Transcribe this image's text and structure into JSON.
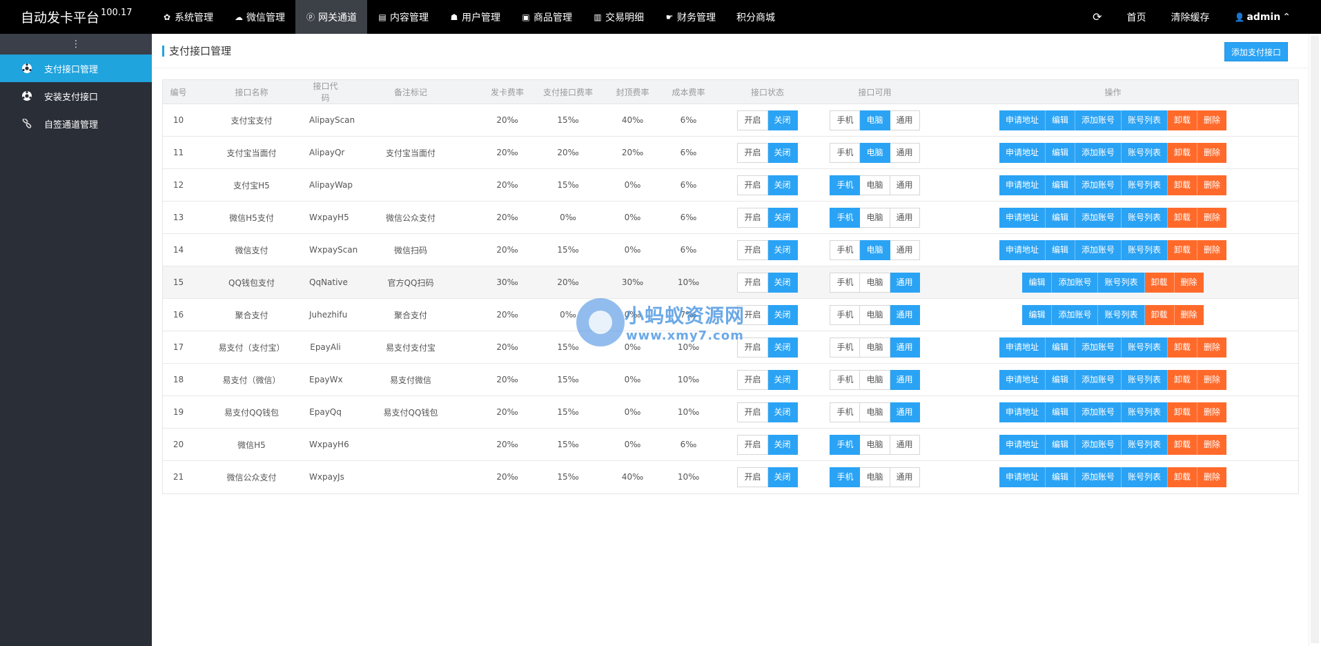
{
  "brand": {
    "name": "自动发卡平台",
    "version": "100.17"
  },
  "topnav": [
    {
      "label": "系统管理",
      "icon": "gear-icon",
      "glyph": "✿"
    },
    {
      "label": "微信管理",
      "icon": "wechat-icon",
      "glyph": "☁"
    },
    {
      "label": "网关通道",
      "icon": "gateway-icon",
      "glyph": "ⓟ",
      "active": true
    },
    {
      "label": "内容管理",
      "icon": "document-icon",
      "glyph": "▤"
    },
    {
      "label": "用户管理",
      "icon": "users-icon",
      "glyph": "☗"
    },
    {
      "label": "商品管理",
      "icon": "bag-icon",
      "glyph": "▣"
    },
    {
      "label": "交易明细",
      "icon": "chart-icon",
      "glyph": "▥"
    },
    {
      "label": "财务管理",
      "icon": "hand-icon",
      "glyph": "☛"
    },
    {
      "label": "积分商城",
      "icon": "",
      "glyph": ""
    }
  ],
  "topright": {
    "refresh_glyph": "⟳",
    "home": "首页",
    "clear_cache": "清除缓存",
    "user": "admin",
    "user_glyph": "👤",
    "caret": "⌃"
  },
  "sidebar": {
    "toggle": "⋮",
    "items": [
      {
        "label": "支付接口管理",
        "icon": "soccer-ball-icon",
        "active": true
      },
      {
        "label": "安装支付接口",
        "icon": "soccer-ball-icon"
      },
      {
        "label": "自签通道管理",
        "icon": "link-icon"
      }
    ]
  },
  "page": {
    "title": "支付接口管理",
    "add_button": "添加支付接口"
  },
  "table": {
    "headers": [
      "编号",
      "接口名称",
      "接口代码",
      "备注标记",
      "发卡费率",
      "支付接口费率",
      "封顶费率",
      "成本费率",
      "接口状态",
      "接口可用",
      "操作"
    ],
    "status_labels": [
      "开启",
      "关闭"
    ],
    "device_labels": [
      "手机",
      "电脑",
      "通用"
    ],
    "op_labels": {
      "apply": "申请地址",
      "edit": "编辑",
      "add_account": "添加账号",
      "account_list": "账号列表",
      "uninstall": "卸载",
      "delete": "删除"
    },
    "rows": [
      {
        "id": "10",
        "name": "支付宝支付",
        "code": "AlipayScan",
        "remark": "",
        "card_rate": "20‰",
        "api_rate": "15‰",
        "cap_rate": "40‰",
        "cost_rate": "6‰",
        "status": 1,
        "device": 1,
        "has_apply": true
      },
      {
        "id": "11",
        "name": "支付宝当面付",
        "code": "AlipayQr",
        "remark": "支付宝当面付",
        "card_rate": "20‰",
        "api_rate": "20‰",
        "cap_rate": "20‰",
        "cost_rate": "6‰",
        "status": 1,
        "device": 1,
        "has_apply": true
      },
      {
        "id": "12",
        "name": "支付宝H5",
        "code": "AlipayWap",
        "remark": "",
        "card_rate": "20‰",
        "api_rate": "15‰",
        "cap_rate": "0‰",
        "cost_rate": "6‰",
        "status": 1,
        "device": 0,
        "has_apply": true
      },
      {
        "id": "13",
        "name": "微信H5支付",
        "code": "WxpayH5",
        "remark": "微信公众支付",
        "card_rate": "20‰",
        "api_rate": "0‰",
        "cap_rate": "0‰",
        "cost_rate": "6‰",
        "status": 1,
        "device": 0,
        "has_apply": true
      },
      {
        "id": "14",
        "name": "微信支付",
        "code": "WxpayScan",
        "remark": "微信扫码",
        "card_rate": "20‰",
        "api_rate": "15‰",
        "cap_rate": "0‰",
        "cost_rate": "6‰",
        "status": 1,
        "device": 1,
        "has_apply": true
      },
      {
        "id": "15",
        "name": "QQ钱包支付",
        "code": "QqNative",
        "remark": "官方QQ扫码",
        "card_rate": "30‰",
        "api_rate": "20‰",
        "cap_rate": "30‰",
        "cost_rate": "10‰",
        "status": 1,
        "device": 2,
        "has_apply": false,
        "highlight": true
      },
      {
        "id": "16",
        "name": "聚合支付",
        "code": "Juhezhifu",
        "remark": "聚合支付",
        "card_rate": "20‰",
        "api_rate": "0‰",
        "cap_rate": "0‰",
        "cost_rate": "7‰",
        "status": 1,
        "device": 2,
        "has_apply": false
      },
      {
        "id": "17",
        "name": "易支付（支付宝）",
        "code": "EpayAli",
        "remark": "易支付支付宝",
        "card_rate": "20‰",
        "api_rate": "15‰",
        "cap_rate": "0‰",
        "cost_rate": "10‰",
        "status": 1,
        "device": 2,
        "has_apply": true
      },
      {
        "id": "18",
        "name": "易支付（微信）",
        "code": "EpayWx",
        "remark": "易支付微信",
        "card_rate": "20‰",
        "api_rate": "15‰",
        "cap_rate": "0‰",
        "cost_rate": "10‰",
        "status": 1,
        "device": 2,
        "has_apply": true
      },
      {
        "id": "19",
        "name": "易支付QQ钱包",
        "code": "EpayQq",
        "remark": "易支付QQ钱包",
        "card_rate": "20‰",
        "api_rate": "15‰",
        "cap_rate": "0‰",
        "cost_rate": "10‰",
        "status": 1,
        "device": 2,
        "has_apply": true
      },
      {
        "id": "20",
        "name": "微信H5",
        "code": "WxpayH6",
        "remark": "",
        "card_rate": "20‰",
        "api_rate": "15‰",
        "cap_rate": "0‰",
        "cost_rate": "6‰",
        "status": 1,
        "device": 0,
        "has_apply": true
      },
      {
        "id": "21",
        "name": "微信公众支付",
        "code": "WxpayJs",
        "remark": "",
        "card_rate": "20‰",
        "api_rate": "15‰",
        "cap_rate": "40‰",
        "cost_rate": "10‰",
        "status": 1,
        "device": 0,
        "has_apply": true
      }
    ]
  },
  "watermark": {
    "line1": "小蚂蚁资源网",
    "line2": "www.xmy7.com"
  },
  "colors": {
    "topbar": "#000000",
    "sidebar": "#2a2e37",
    "accent": "#1fa4de",
    "button": "#2aa3f5",
    "danger": "#ff6a2b"
  }
}
